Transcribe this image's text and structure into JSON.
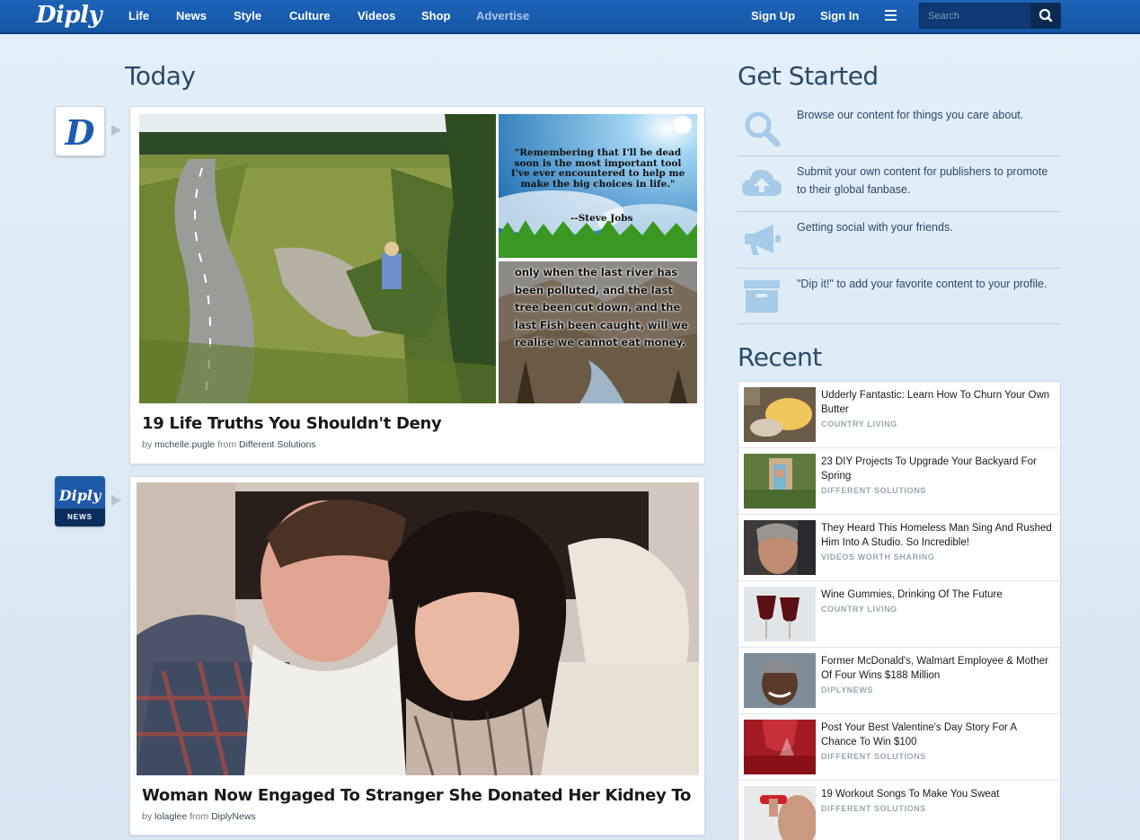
{
  "header": {
    "logo": "Diply",
    "nav": [
      "Life",
      "News",
      "Style",
      "Culture",
      "Videos",
      "Shop",
      "Advertise"
    ],
    "sign_up": "Sign Up",
    "sign_in": "Sign In",
    "search_placeholder": "Search"
  },
  "feed": {
    "heading": "Today",
    "posts": [
      {
        "title": "19 Life Truths You Shouldn't Deny",
        "by": "by",
        "author": "michelle.pugle",
        "from": "from",
        "source": "Different Solutions",
        "avatar_letter": "D",
        "quote_1": "\"Remembering that I'll be dead soon is the most important tool I've ever encountered to help me make the big choices in life.\"",
        "quote_1_author": "--Steve Jobs",
        "quote_2": "only when the last river has been polluted, and the last tree been cut down, and the last Fish been caught, will we realise we cannot eat money."
      },
      {
        "title": "Woman Now Engaged To Stranger She Donated Her Kidney To",
        "by": "by",
        "author": "lolaglee",
        "from": "from",
        "source": "DiplyNews",
        "avatar_word": "Diply",
        "avatar_band": "NEWS"
      }
    ]
  },
  "get_started": {
    "heading": "Get Started",
    "items": [
      {
        "icon": "search-icon",
        "text": "Browse our content for things you care about."
      },
      {
        "icon": "cloud-upload-icon",
        "text": "Submit your own content for publishers to promote to their global fanbase."
      },
      {
        "icon": "megaphone-icon",
        "text": "Getting social with your friends."
      },
      {
        "icon": "archive-box-icon",
        "text": "\"Dip it!\" to add your favorite content to your profile."
      }
    ]
  },
  "recent": {
    "heading": "Recent",
    "items": [
      {
        "title": "Udderly Fantastic: Learn How To Churn Your Own Butter",
        "source": "COUNTRY LIVING"
      },
      {
        "title": "23 DIY Projects To Upgrade Your Backyard For Spring",
        "source": "DIFFERENT SOLUTIONS"
      },
      {
        "title": "They Heard This Homeless Man Sing And Rushed Him Into A Studio. So Incredible!",
        "source": "VIDEOS WORTH SHARING"
      },
      {
        "title": "Wine Gummies, Drinking Of The Future",
        "source": "COUNTRY LIVING"
      },
      {
        "title": "Former McDonald's, Walmart Employee & Mother Of Four Wins $188 Million",
        "source": "DIPLYNEWS"
      },
      {
        "title": "Post Your Best Valentine's Day Story For A Chance To Win $100",
        "source": "DIFFERENT SOLUTIONS"
      },
      {
        "title": "19 Workout Songs To Make You Sweat",
        "source": "DIFFERENT SOLUTIONS"
      }
    ]
  },
  "colors": {
    "nav_bg": "#1a5fb1",
    "page_bg": "#dfedf8",
    "heading": "#2a4a68",
    "icon": "#a7cbe8"
  }
}
